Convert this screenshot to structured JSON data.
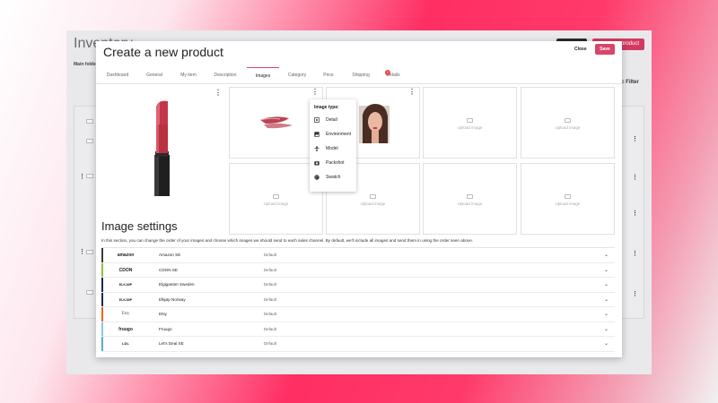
{
  "background": {
    "title": "Inventory",
    "main_folder": "Main folder",
    "filter_label": "Filter",
    "add_button": "product"
  },
  "modal": {
    "title": "Create a new product",
    "close_label": "Close",
    "save_label": "Save"
  },
  "tabs": [
    {
      "label": "Dashboard"
    },
    {
      "label": "General"
    },
    {
      "label": "My item"
    },
    {
      "label": "Description"
    },
    {
      "label": "Images"
    },
    {
      "label": "Category"
    },
    {
      "label": "Price"
    },
    {
      "label": "Shipping"
    },
    {
      "label": "Details"
    }
  ],
  "details_badge": "0",
  "upload_label": "Upload image",
  "image_type_menu": {
    "title": "Image type:",
    "items": [
      {
        "label": "Detail",
        "icon": "detail-icon"
      },
      {
        "label": "Environment",
        "icon": "image-icon"
      },
      {
        "label": "Model",
        "icon": "person-icon"
      },
      {
        "label": "Packshot",
        "icon": "camera-icon"
      },
      {
        "label": "Swatch",
        "icon": "palette-icon"
      }
    ]
  },
  "image_settings": {
    "title": "Image settings",
    "description": "In this section, you can change the order of your images and choose which images we should send to each sales channel. By default, we'll include all images and send them in using the order seen above."
  },
  "channels": [
    {
      "logo": "amazon",
      "name": "Amazon SE",
      "value": "Default",
      "color": "#3b3b3b"
    },
    {
      "logo": "CDON",
      "name": "CDON SE",
      "value": "Default",
      "color": "#8fc33f"
    },
    {
      "logo": "ELKJØP",
      "name": "Elgiganten Sweden",
      "value": "Default",
      "color": "#1f2a55"
    },
    {
      "logo": "ELKJØP",
      "name": "Elkjøp Norway",
      "value": "Default",
      "color": "#1f2a55"
    },
    {
      "logo": "Etsy",
      "name": "Etsy",
      "value": "Default",
      "color": "#f1641e"
    },
    {
      "logo": "fruugo",
      "name": "Fruugo",
      "value": "Default",
      "color": "#8bc6e8"
    },
    {
      "logo": "LDL",
      "name": "Let's Deal SE",
      "value": "Default",
      "color": "#5ab1c9"
    }
  ],
  "colors": {
    "accent": "#d94467",
    "badge": "#e34242"
  }
}
